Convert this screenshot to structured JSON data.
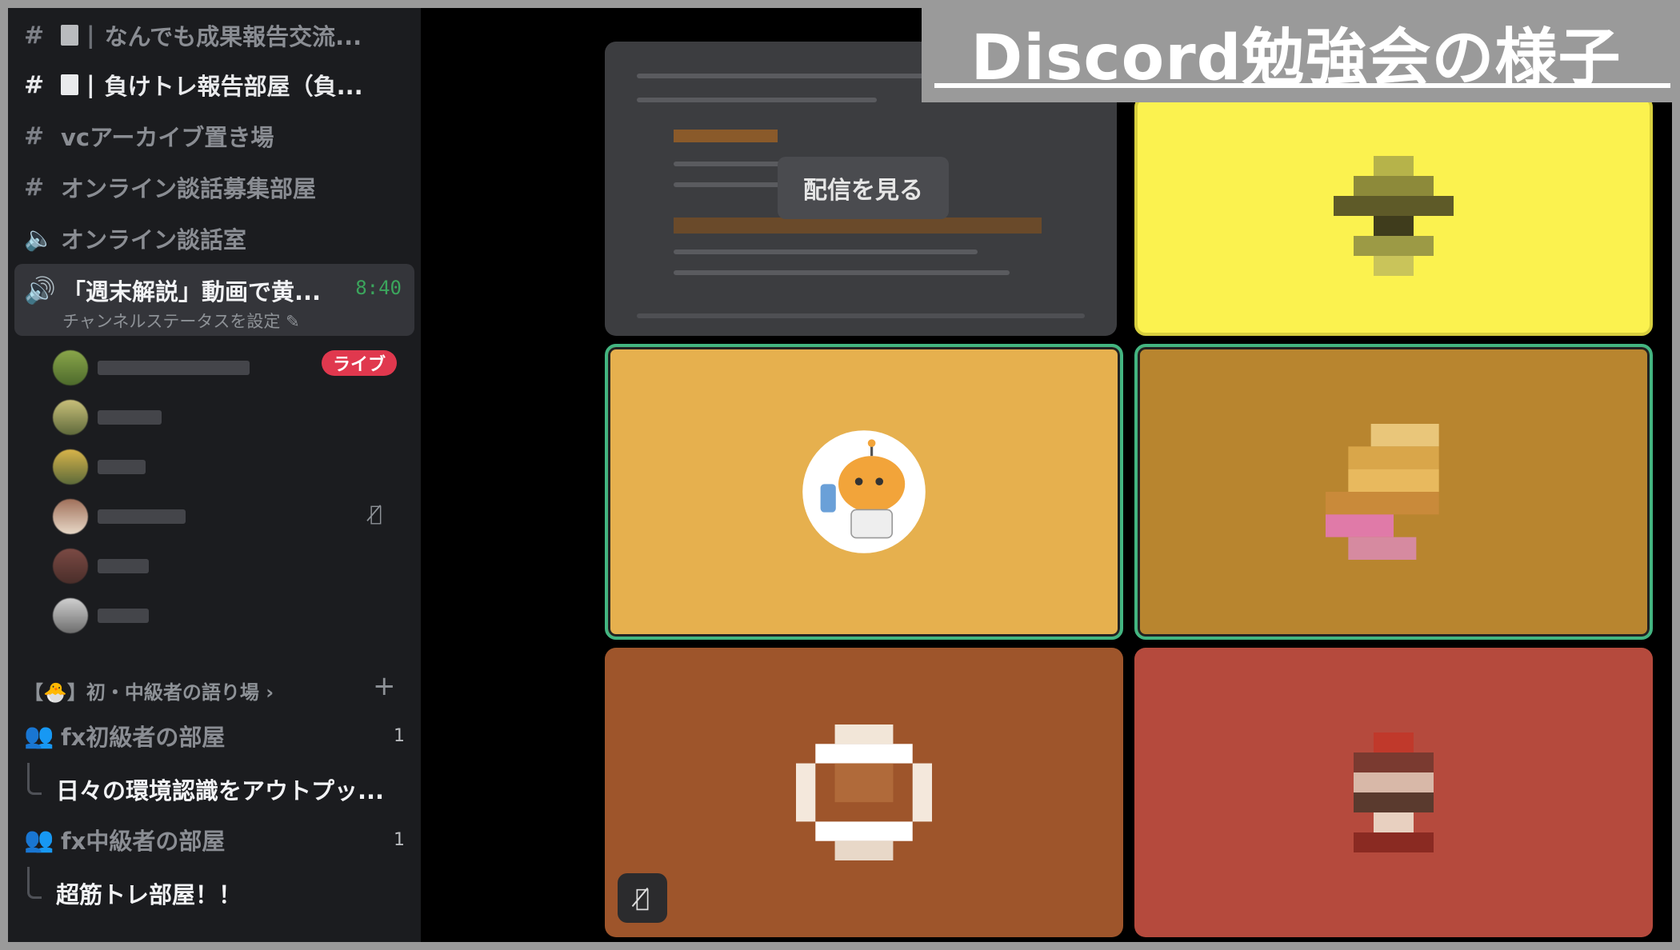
{
  "banner": {
    "title": "Discord勉強会の様子"
  },
  "sidebar": {
    "channels": [
      {
        "label": "なんでも成果報告交流..."
      },
      {
        "label": "負けトレ報告部屋（負..."
      },
      {
        "label": "vcアーカイブ置き場"
      },
      {
        "label": "オンライン談話募集部屋"
      },
      {
        "label": "オンライン談話室"
      }
    ],
    "active_voice": {
      "title": "「週末解説」動画で黄...",
      "time": "8:40",
      "status": "チャンネルステータスを設定"
    },
    "live_badge": "ライブ",
    "category": "【🐣】初・中級者の語り場",
    "rooms": [
      {
        "label": "fx初級者の部屋",
        "count": "1",
        "thread": "日々の環境認識をアウトプッ..."
      },
      {
        "label": "fx中級者の部屋",
        "count": "1",
        "thread": "超筋トレ部屋！！"
      }
    ]
  },
  "stage": {
    "watch_stream_label": "配信を見る"
  },
  "colors": {
    "tile_yellow": "#fbf24f",
    "tile_orange": "#e6b04e",
    "tile_gold": "#b8852f",
    "tile_brown": "#9e552b",
    "tile_red": "#b54a3d",
    "speaking_border": "#43b581"
  }
}
